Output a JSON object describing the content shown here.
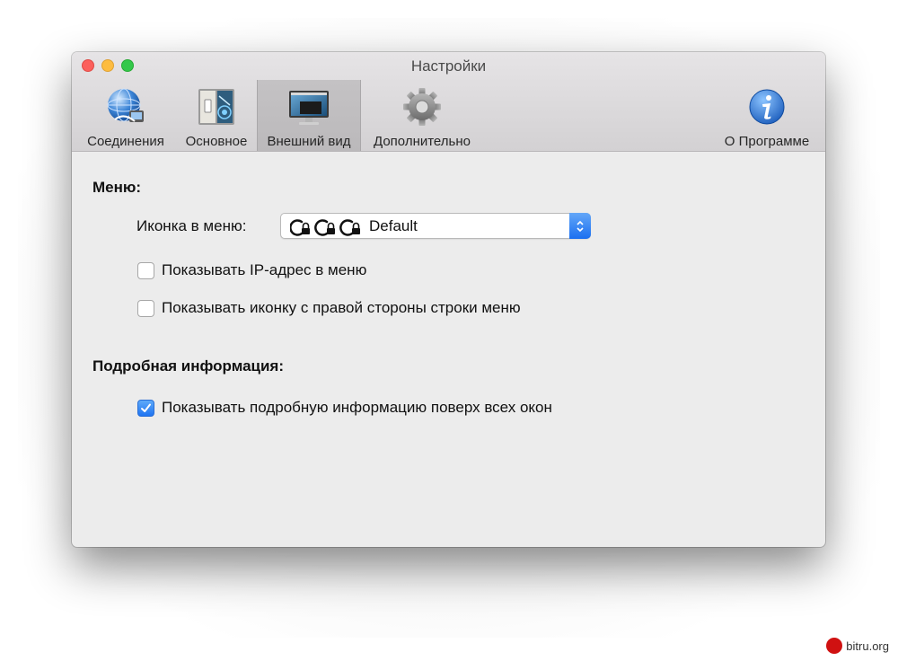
{
  "window": {
    "title": "Настройки"
  },
  "toolbar": {
    "tabs": [
      {
        "label": "Соединения",
        "icon": "globe-network-icon"
      },
      {
        "label": "Основное",
        "icon": "switch-panel-icon"
      },
      {
        "label": "Внешний вид",
        "icon": "monitor-icon",
        "selected": true
      },
      {
        "label": "Дополнительно",
        "icon": "gear-icon"
      },
      {
        "label": "О Программе",
        "icon": "info-icon"
      }
    ]
  },
  "menu_section": {
    "heading": "Меню:",
    "icon_label": "Иконка в меню:",
    "icon_select_value": "Default",
    "show_ip_label": "Показывать IP-адрес в меню",
    "show_ip_checked": false,
    "show_icon_right_label": "Показывать иконку с правой стороны строки меню",
    "show_icon_right_checked": false
  },
  "details_section": {
    "heading": "Подробная информация:",
    "show_on_top_label": "Показывать подробную информацию поверх всех окон",
    "show_on_top_checked": true
  },
  "watermark": {
    "text": "bitru.org"
  },
  "colors": {
    "accent": "#1f74f2",
    "close": "#fc605c",
    "minimize": "#fdbc40",
    "maximize": "#34c84a"
  }
}
